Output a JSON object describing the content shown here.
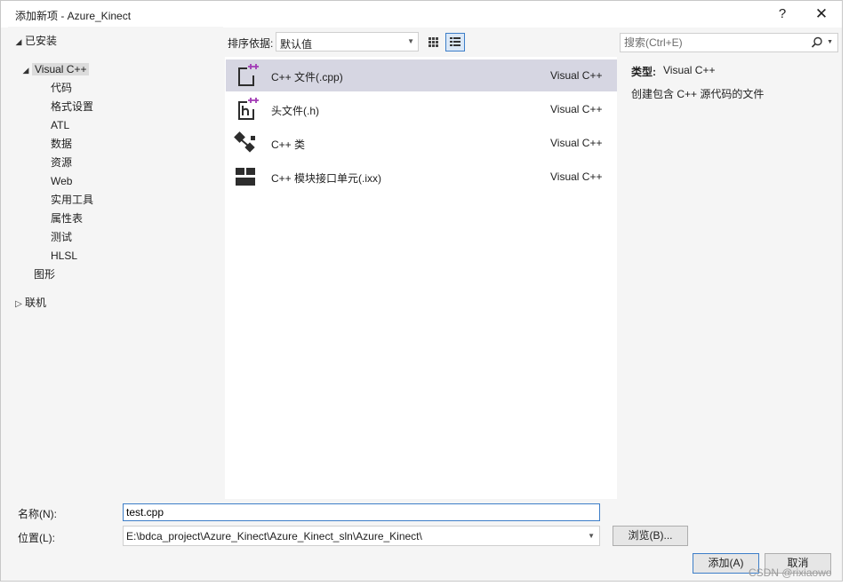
{
  "window": {
    "title": "添加新项 - Azure_Kinect",
    "help_label": "?",
    "close_label": "✕"
  },
  "tree": {
    "installed": "已安装",
    "visual_cpp": "Visual C++",
    "children": [
      "代码",
      "格式设置",
      "ATL",
      "数据",
      "资源",
      "Web",
      "实用工具",
      "属性表",
      "测试",
      "HLSL"
    ],
    "graphics": "图形",
    "online": "联机"
  },
  "toolbar": {
    "sort_label": "排序依据:",
    "sort_value": "默认值"
  },
  "search": {
    "placeholder": "搜索(Ctrl+E)"
  },
  "items": [
    {
      "name": "C++ 文件(.cpp)",
      "lang": "Visual C++",
      "icon": "cpp-file-icon",
      "selected": true
    },
    {
      "name": "头文件(.h)",
      "lang": "Visual C++",
      "icon": "header-file-icon",
      "selected": false
    },
    {
      "name": "C++ 类",
      "lang": "Visual C++",
      "icon": "class-icon",
      "selected": false
    },
    {
      "name": "C++ 模块接口单元(.ixx)",
      "lang": "Visual C++",
      "icon": "module-icon",
      "selected": false
    }
  ],
  "info": {
    "type_label": "类型:",
    "type_value": "Visual C++",
    "description": "创建包含 C++ 源代码的文件"
  },
  "form": {
    "name_label": "名称(N):",
    "name_value": "test.cpp",
    "location_label": "位置(L):",
    "location_value": "E:\\bdca_project\\Azure_Kinect\\Azure_Kinect_sln\\Azure_Kinect\\",
    "browse_label": "浏览(B)...",
    "add_label": "添加(A)",
    "cancel_label": "取消"
  },
  "watermark": "CSDN @rixiaowo",
  "colors": {
    "accent": "#3d7ec8",
    "selected_row": "#d6d6e2"
  }
}
